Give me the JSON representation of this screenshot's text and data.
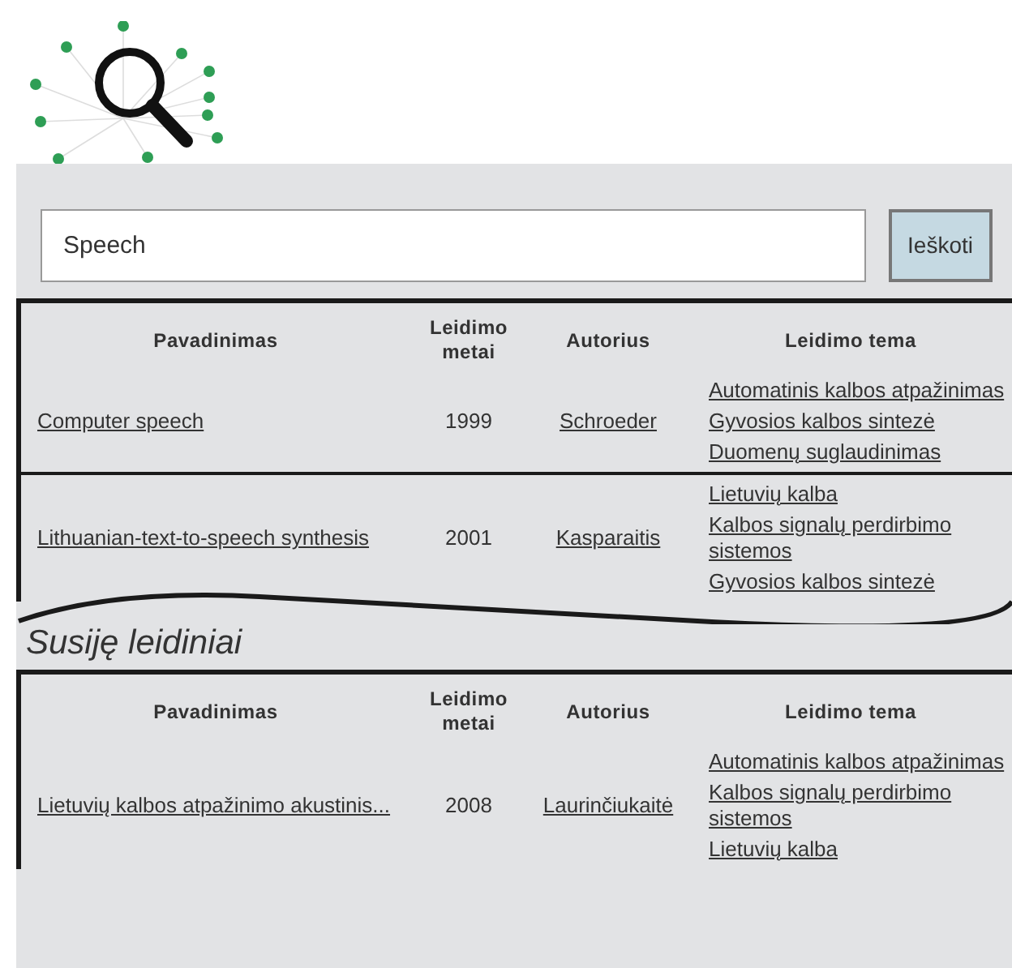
{
  "search": {
    "value": "Speech",
    "button": "Ieškoti"
  },
  "results": {
    "columns": [
      "Pavadinimas",
      "Leidimo metai",
      "Autorius",
      "Leidimo tema"
    ],
    "rows": [
      {
        "title": "Computer speech",
        "year": "1999",
        "author": "Schroeder",
        "topics": [
          "Automatinis kalbos atpažinimas",
          "Gyvosios kalbos sintezė",
          "Duomenų suglaudinimas"
        ]
      },
      {
        "title": "Lithuanian-text-to-speech synthesis",
        "year": "2001",
        "author": "Kasparaitis",
        "topics": [
          "Lietuvių kalba",
          "Kalbos signalų perdirbimo sistemos",
          "Gyvosios kalbos sintezė"
        ]
      }
    ]
  },
  "related": {
    "heading": "Susiję leidiniai",
    "columns": [
      "Pavadinimas",
      "Leidimo metai",
      "Autorius",
      "Leidimo tema"
    ],
    "rows": [
      {
        "title": "Lietuvių kalbos atpažinimo akustinis...",
        "year": "2008",
        "author": "Laurinčiukaitė",
        "topics": [
          "Automatinis kalbos atpažinimas",
          "Kalbos signalų perdirbimo sistemos",
          "Lietuvių kalba"
        ]
      }
    ]
  }
}
